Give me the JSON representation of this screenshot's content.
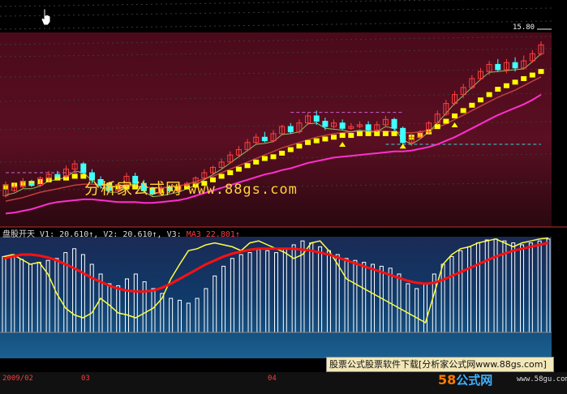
{
  "indicator_header": {
    "name": "盘股开天",
    "v1": "V1: 20.610↑,",
    "v2": "V2: 20.610↑,",
    "v3": "V3:",
    "ma3": "MA3  22.801↑"
  },
  "last_price": "15.80",
  "watermark": {
    "text": "分析家公式网",
    "url": "www.88gs.com"
  },
  "download_banner": "股票公式股票软件下载[分析家公式网www.88gs.com]",
  "logo": {
    "num": "58",
    "cn": "公式网",
    "site": "www.58gu.com"
  },
  "date_labels": [
    "2009/02",
    "03",
    "04"
  ],
  "colors": {
    "up": "#ff4040",
    "down": "#40ffff",
    "ma_fast": "#ff2fd0",
    "ma_mid": "#c04040",
    "stop": "#ffff00",
    "hist": "#ffffff",
    "ind_line": "#ffff40",
    "ind_ma": "#ff1010"
  },
  "chart_data": [
    {
      "type": "candlestick",
      "title": "",
      "last_price": 15.8,
      "candles": [
        [
          7.3,
          7.9,
          7.2,
          8.1
        ],
        [
          7.6,
          7.8,
          7.5,
          8.0
        ],
        [
          7.8,
          8.1,
          7.7,
          8.3
        ],
        [
          8.0,
          7.9,
          7.8,
          8.2
        ],
        [
          7.9,
          8.3,
          7.8,
          8.4
        ],
        [
          8.3,
          8.5,
          8.1,
          8.7
        ],
        [
          8.5,
          8.4,
          8.2,
          8.7
        ],
        [
          8.4,
          8.8,
          8.3,
          9.0
        ],
        [
          8.8,
          9.1,
          8.6,
          9.3
        ],
        [
          9.1,
          8.6,
          8.5,
          9.2
        ],
        [
          8.6,
          8.2,
          8.0,
          8.8
        ],
        [
          8.2,
          7.9,
          7.7,
          8.4
        ],
        [
          7.9,
          7.6,
          7.5,
          8.1
        ],
        [
          7.6,
          7.9,
          7.4,
          8.0
        ],
        [
          7.9,
          8.4,
          7.8,
          8.6
        ],
        [
          8.4,
          8.0,
          7.9,
          8.6
        ],
        [
          8.0,
          7.6,
          7.5,
          8.2
        ],
        [
          7.6,
          7.4,
          7.3,
          7.8
        ],
        [
          7.4,
          7.7,
          7.3,
          7.9
        ],
        [
          7.7,
          7.6,
          7.5,
          7.9
        ],
        [
          7.6,
          7.9,
          7.5,
          8.0
        ],
        [
          7.9,
          8.0,
          7.8,
          8.1
        ],
        [
          8.0,
          8.3,
          7.9,
          8.4
        ],
        [
          8.3,
          8.6,
          8.2,
          8.8
        ],
        [
          8.6,
          8.9,
          8.5,
          9.0
        ],
        [
          8.9,
          9.2,
          8.8,
          9.4
        ],
        [
          9.2,
          9.6,
          9.1,
          9.8
        ],
        [
          9.6,
          9.9,
          9.5,
          10.1
        ],
        [
          9.9,
          10.3,
          9.8,
          10.5
        ],
        [
          10.3,
          10.6,
          10.2,
          10.8
        ],
        [
          10.6,
          10.4,
          10.3,
          10.9
        ],
        [
          10.4,
          10.8,
          10.3,
          11.0
        ],
        [
          10.8,
          11.2,
          10.7,
          11.3
        ],
        [
          11.2,
          10.9,
          10.8,
          11.4
        ],
        [
          10.9,
          11.4,
          10.8,
          11.6
        ],
        [
          11.4,
          11.8,
          11.3,
          12.0
        ],
        [
          11.8,
          11.5,
          11.3,
          12.1
        ],
        [
          11.5,
          11.2,
          11.0,
          11.7
        ],
        [
          11.2,
          11.4,
          11.1,
          11.6
        ],
        [
          11.4,
          11.1,
          11.0,
          11.6
        ],
        [
          11.1,
          11.2,
          11.0,
          11.4
        ],
        [
          11.2,
          11.3,
          11.1,
          11.5
        ],
        [
          11.3,
          11.0,
          10.9,
          11.5
        ],
        [
          11.0,
          11.3,
          10.9,
          11.5
        ],
        [
          11.3,
          11.6,
          11.2,
          11.8
        ],
        [
          11.6,
          11.1,
          10.9,
          11.7
        ],
        [
          11.1,
          10.3,
          10.2,
          11.2
        ],
        [
          10.3,
          10.6,
          10.1,
          10.8
        ],
        [
          10.6,
          10.9,
          10.5,
          11.0
        ],
        [
          10.9,
          11.4,
          10.8,
          11.5
        ],
        [
          11.4,
          11.9,
          11.3,
          12.1
        ],
        [
          11.9,
          12.5,
          11.8,
          12.7
        ],
        [
          12.5,
          13.0,
          12.4,
          13.2
        ],
        [
          13.0,
          13.4,
          12.8,
          13.6
        ],
        [
          13.4,
          13.9,
          13.3,
          14.1
        ],
        [
          13.9,
          14.3,
          13.8,
          14.5
        ],
        [
          14.3,
          14.7,
          14.1,
          14.9
        ],
        [
          14.7,
          14.4,
          14.3,
          15.0
        ],
        [
          14.4,
          14.8,
          14.2,
          15.0
        ],
        [
          14.8,
          14.5,
          14.3,
          15.1
        ],
        [
          14.5,
          14.9,
          14.4,
          15.2
        ],
        [
          14.9,
          15.3,
          14.8,
          15.5
        ],
        [
          15.3,
          15.8,
          15.2,
          16.0
        ]
      ],
      "ma_fast": [
        6.3,
        6.35,
        6.45,
        6.55,
        6.7,
        6.85,
        6.95,
        7.0,
        7.05,
        7.1,
        7.1,
        7.05,
        7.0,
        6.95,
        6.95,
        6.95,
        6.9,
        6.9,
        6.95,
        7.0,
        7.05,
        7.15,
        7.3,
        7.45,
        7.6,
        7.75,
        7.9,
        8.05,
        8.2,
        8.35,
        8.5,
        8.6,
        8.75,
        8.85,
        9.0,
        9.15,
        9.25,
        9.35,
        9.45,
        9.5,
        9.55,
        9.6,
        9.65,
        9.7,
        9.75,
        9.8,
        9.8,
        9.85,
        9.95,
        10.05,
        10.2,
        10.4,
        10.6,
        10.85,
        11.1,
        11.35,
        11.6,
        11.85,
        12.05,
        12.25,
        12.45,
        12.7,
        13.0
      ],
      "ma_mid": [
        7.0,
        7.1,
        7.2,
        7.35,
        7.5,
        7.6,
        7.7,
        7.8,
        7.9,
        7.95,
        7.95,
        7.9,
        7.85,
        7.8,
        7.85,
        7.85,
        7.8,
        7.75,
        7.75,
        7.8,
        7.85,
        7.95,
        8.1,
        8.25,
        8.4,
        8.6,
        8.8,
        9.0,
        9.2,
        9.4,
        9.6,
        9.8,
        10.0,
        10.15,
        10.3,
        10.45,
        10.6,
        10.7,
        10.8,
        10.85,
        10.9,
        10.95,
        10.95,
        10.95,
        10.95,
        10.9,
        10.85,
        10.85,
        10.9,
        11.0,
        11.15,
        11.35,
        11.6,
        11.85,
        12.1,
        12.35,
        12.6,
        12.85,
        13.05,
        13.25,
        13.5,
        13.75,
        14.0
      ],
      "stop_levels": [
        7.8,
        7.9,
        8.0,
        8.0,
        8.1,
        8.2,
        8.3,
        8.3,
        8.4,
        8.4,
        8.3,
        8.1,
        7.9,
        7.8,
        7.8,
        7.8,
        7.7,
        7.6,
        7.6,
        7.7,
        7.7,
        7.8,
        7.9,
        8.0,
        8.2,
        8.4,
        8.6,
        8.8,
        9.0,
        9.2,
        9.4,
        9.5,
        9.7,
        9.9,
        10.1,
        10.3,
        10.4,
        10.5,
        10.6,
        10.7,
        10.7,
        10.8,
        10.8,
        10.8,
        10.8,
        10.8,
        10.6,
        10.6,
        10.7,
        10.9,
        11.2,
        11.5,
        11.8,
        12.1,
        12.4,
        12.7,
        13.0,
        13.3,
        13.5,
        13.7,
        13.9,
        14.1,
        14.3
      ],
      "ylim": [
        6.0,
        16.5
      ]
    },
    {
      "type": "bar",
      "title": "盘股开天",
      "hist": [
        78,
        80,
        75,
        70,
        72,
        74,
        76,
        82,
        86,
        80,
        70,
        60,
        50,
        48,
        55,
        60,
        52,
        45,
        40,
        35,
        33,
        30,
        35,
        45,
        58,
        68,
        76,
        80,
        82,
        85,
        84,
        82,
        86,
        90,
        94,
        92,
        88,
        84,
        80,
        76,
        74,
        72,
        70,
        68,
        66,
        60,
        50,
        45,
        50,
        60,
        70,
        78,
        84,
        88,
        92,
        95,
        96,
        94,
        92,
        90,
        92,
        94,
        96
      ],
      "line": [
        78,
        80,
        75,
        70,
        72,
        60,
        40,
        25,
        18,
        15,
        20,
        35,
        28,
        20,
        18,
        15,
        20,
        25,
        35,
        55,
        70,
        84,
        86,
        90,
        92,
        90,
        88,
        84,
        92,
        94,
        90,
        86,
        82,
        76,
        80,
        92,
        94,
        84,
        70,
        55,
        50,
        45,
        40,
        35,
        30,
        25,
        20,
        15,
        10,
        40,
        70,
        80,
        86,
        88,
        92,
        94,
        96,
        92,
        88,
        92,
        94,
        96,
        97
      ],
      "ma": [
        76,
        78,
        80,
        80,
        79,
        77,
        74,
        70,
        66,
        61,
        56,
        52,
        48,
        45,
        43,
        42,
        42,
        43,
        46,
        50,
        55,
        60,
        65,
        70,
        74,
        78,
        81,
        83,
        85,
        86,
        86,
        86,
        86,
        86,
        85,
        84,
        82,
        80,
        77,
        74,
        71,
        68,
        65,
        62,
        59,
        56,
        53,
        51,
        50,
        51,
        54,
        58,
        62,
        66,
        70,
        74,
        78,
        81,
        84,
        86,
        88,
        90,
        92
      ],
      "ylim": [
        0,
        100
      ]
    }
  ]
}
